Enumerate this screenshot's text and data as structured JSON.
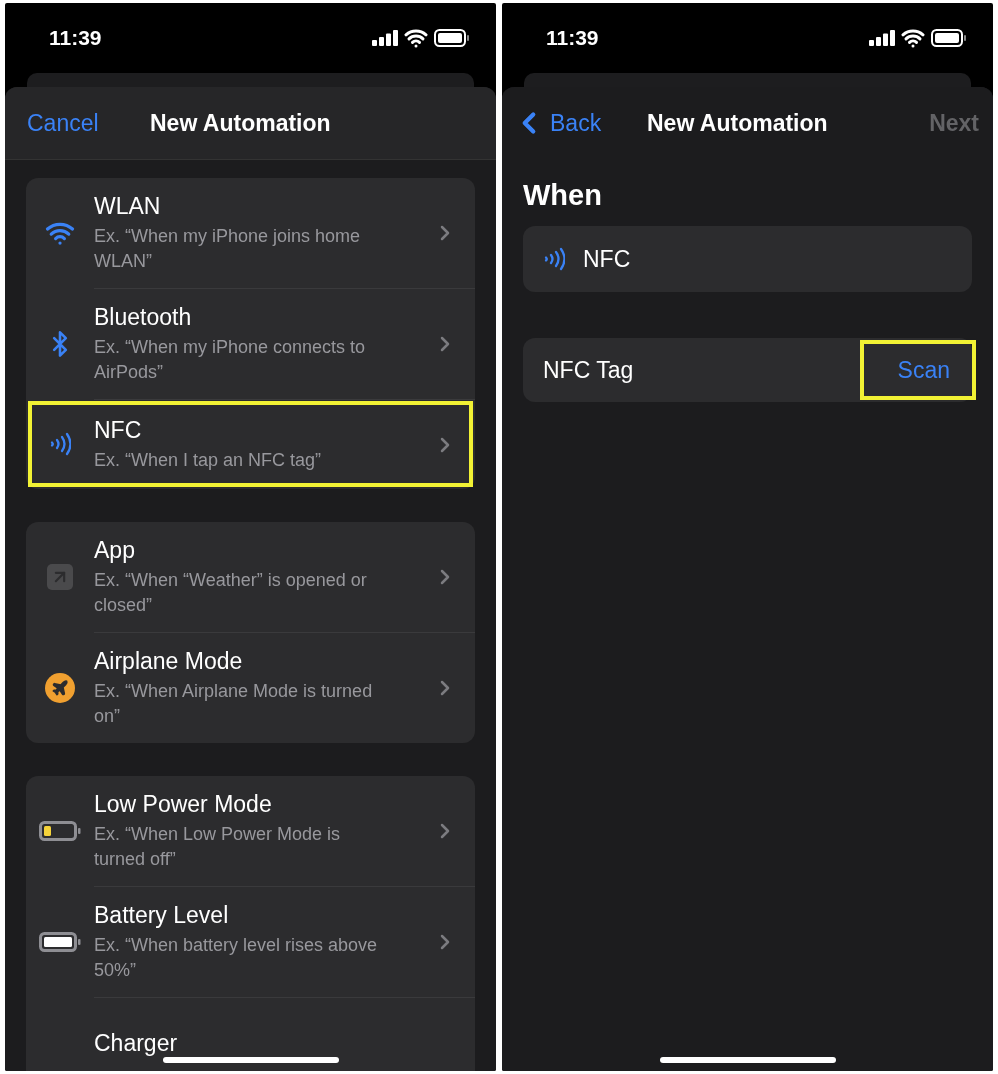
{
  "left_screen": {
    "status_bar": {
      "time": "11:39"
    },
    "nav": {
      "cancel": "Cancel",
      "title": "New Automation"
    },
    "groups": [
      {
        "items": [
          {
            "kind": "wifi",
            "title": "WLAN",
            "subtitle": "Ex. “When my iPhone joins home WLAN”",
            "highlighted": false
          },
          {
            "kind": "bluetooth",
            "title": "Bluetooth",
            "subtitle": "Ex. “When my iPhone connects to AirPods”",
            "highlighted": false
          },
          {
            "kind": "nfc",
            "title": "NFC",
            "subtitle": "Ex. “When I tap an NFC tag”",
            "highlighted": true
          }
        ]
      },
      {
        "items": [
          {
            "kind": "app",
            "title": "App",
            "subtitle": "Ex. “When “Weather” is opened or closed”",
            "highlighted": false
          },
          {
            "kind": "airplane",
            "title": "Airplane Mode",
            "subtitle": "Ex. “When Airplane Mode is turned on”",
            "highlighted": false
          }
        ]
      },
      {
        "items": [
          {
            "kind": "lowpower",
            "title": "Low Power Mode",
            "subtitle": "Ex. “When Low Power Mode is turned off”",
            "highlighted": false
          },
          {
            "kind": "battery",
            "title": "Battery Level",
            "subtitle": "Ex. “When battery level rises above 50%”",
            "highlighted": false
          },
          {
            "kind": "charger",
            "title": "Charger",
            "highlighted": false
          }
        ]
      }
    ]
  },
  "right_screen": {
    "status_bar": {
      "time": "11:39"
    },
    "nav": {
      "back": "Back",
      "title": "New Automation",
      "next": {
        "label": "Next",
        "disabled": true
      }
    },
    "section_title": "When",
    "trigger": {
      "kind": "nfc",
      "label": "NFC"
    },
    "tag_row": {
      "label": "NFC Tag",
      "action": "Scan",
      "highlighted": true
    }
  }
}
